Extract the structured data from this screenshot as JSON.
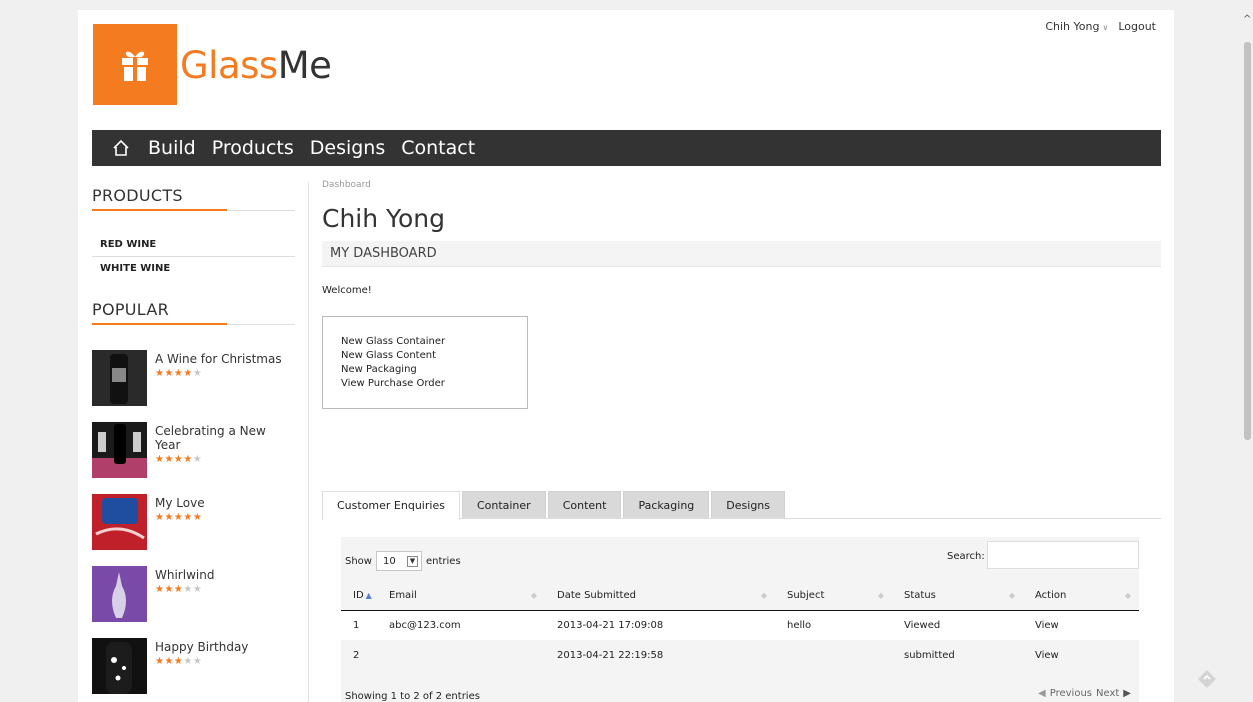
{
  "brand": {
    "part1": "Glass",
    "part2": "Me"
  },
  "user_menu": {
    "user": "Chih Yong",
    "logout": "Logout"
  },
  "nav": {
    "items": [
      "Build",
      "Products",
      "Designs",
      "Contact"
    ]
  },
  "sidebar": {
    "products_heading": "PRODUCTS",
    "products": [
      "RED WINE",
      "WHITE WINE"
    ],
    "popular_heading": "POPULAR",
    "popular": [
      {
        "title": "A Wine for Christmas",
        "rating": 4
      },
      {
        "title": "Celebrating a New Year",
        "rating": 4
      },
      {
        "title": "My Love",
        "rating": 5
      },
      {
        "title": "Whirlwind",
        "rating": 3
      },
      {
        "title": "Happy Birthday",
        "rating": 3
      }
    ]
  },
  "main": {
    "breadcrumb": "Dashboard",
    "title": "Chih Yong",
    "section": "MY DASHBOARD",
    "welcome": "Welcome!",
    "quick_links": [
      "New Glass Container",
      "New Glass Content",
      "New Packaging",
      "View Purchase Order"
    ],
    "tabs": [
      "Customer Enquiries",
      "Container",
      "Content",
      "Packaging",
      "Designs"
    ],
    "table": {
      "show_label": "Show",
      "entries_value": "10",
      "entries_label": "entries",
      "search_label": "Search:",
      "columns": [
        "ID",
        "Email",
        "Date Submitted",
        "Subject",
        "Status",
        "Action"
      ],
      "rows": [
        [
          "1",
          "abc@123.com",
          "2013-04-21 17:09:08",
          "hello",
          "Viewed",
          "View"
        ],
        [
          "2",
          "",
          "2013-04-21 22:19:58",
          "",
          "submitted",
          "View"
        ]
      ],
      "info": "Showing 1 to 2 of 2 entries",
      "previous": "Previous",
      "next": "Next"
    }
  },
  "colors": {
    "accent": "#f47b20",
    "navbar": "#333333"
  }
}
